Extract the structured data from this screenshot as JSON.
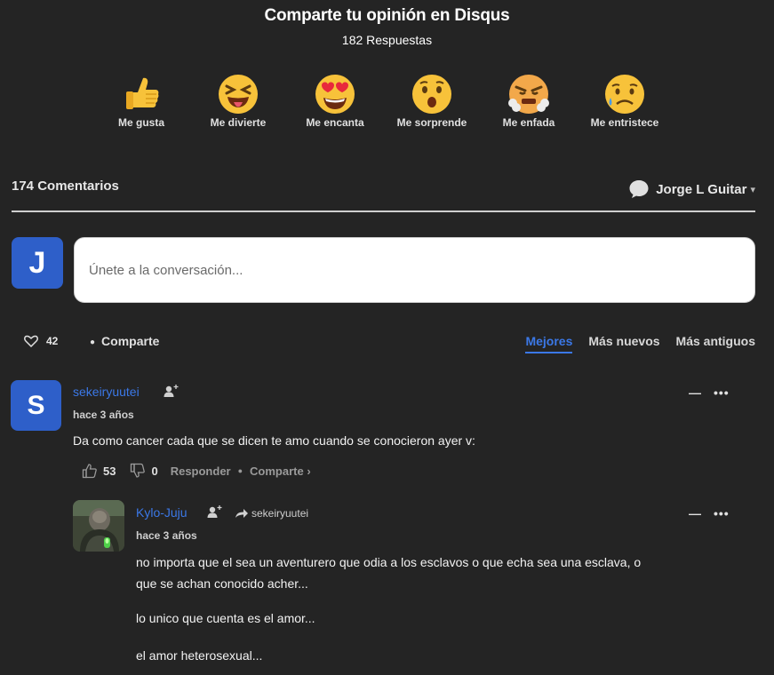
{
  "header": {
    "title": "Comparte tu opinión en Disqus",
    "subtitle": "182 Respuestas"
  },
  "reactions": [
    {
      "label": "Me gusta",
      "icon": "thumbs-up-icon"
    },
    {
      "label": "Me divierte",
      "icon": "laughing-face-icon"
    },
    {
      "label": "Me encanta",
      "icon": "heart-eyes-icon"
    },
    {
      "label": "Me sorprende",
      "icon": "surprised-face-icon"
    },
    {
      "label": "Me enfada",
      "icon": "angry-face-icon"
    },
    {
      "label": "Me entristece",
      "icon": "sad-face-icon"
    }
  ],
  "thread": {
    "count_label": "174 Comentarios",
    "user_name": "Jorge L Guitar",
    "user_caret": "▾"
  },
  "composer": {
    "avatar_letter": "J",
    "placeholder": "Únete a la conversación..."
  },
  "actions": {
    "favorites": "42",
    "share": "Comparte",
    "sort_options": [
      "Mejores",
      "Más nuevos",
      "Más antiguos"
    ],
    "active_sort": "Mejores"
  },
  "comments": [
    {
      "avatar_letter": "S",
      "author": "sekeiryuutei",
      "time": "hace 3 años",
      "text": "Da como cancer cada que se dicen te amo cuando se conocieron ayer v:",
      "upvotes": "53",
      "downvotes": "0",
      "reply_label": "Responder",
      "share_label": "Comparte ›",
      "collapse": "—",
      "more": "•••"
    },
    {
      "author": "Kylo-Juju",
      "reply_to": "sekeiryuutei",
      "time": "hace 3 años",
      "paragraphs": [
        "no importa que el sea un aventurero que odia a los esclavos o que echa sea una esclava, o",
        "que se achan conocido acher...",
        "lo unico que cuenta es el amor...",
        "el amor heterosexual..."
      ],
      "collapse": "—",
      "more": "•••"
    }
  ],
  "colors": {
    "background": "#242424",
    "accent": "#3b78e7",
    "avatar_blue": "#2e5fc9"
  }
}
